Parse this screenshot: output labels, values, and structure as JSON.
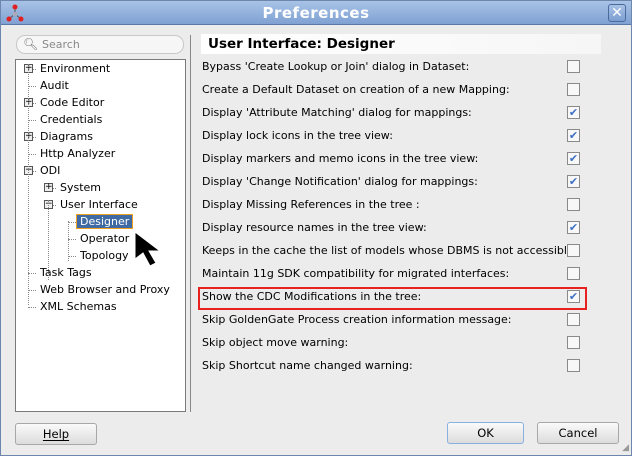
{
  "window": {
    "title": "Preferences"
  },
  "search": {
    "placeholder": "Search"
  },
  "tree": [
    {
      "label": "Environment",
      "level": 0,
      "expander": "+"
    },
    {
      "label": "Audit",
      "level": 0,
      "expander": ""
    },
    {
      "label": "Code Editor",
      "level": 0,
      "expander": "+"
    },
    {
      "label": "Credentials",
      "level": 0,
      "expander": ""
    },
    {
      "label": "Diagrams",
      "level": 0,
      "expander": "+"
    },
    {
      "label": "Http Analyzer",
      "level": 0,
      "expander": ""
    },
    {
      "label": "ODI",
      "level": 0,
      "expander": "−"
    },
    {
      "label": "System",
      "level": 1,
      "expander": "+"
    },
    {
      "label": "User Interface",
      "level": 1,
      "expander": "−"
    },
    {
      "label": "Designer",
      "level": 2,
      "expander": "",
      "selected": true
    },
    {
      "label": "Operator",
      "level": 2,
      "expander": ""
    },
    {
      "label": "Topology",
      "level": 2,
      "expander": ""
    },
    {
      "label": "Task Tags",
      "level": 0,
      "expander": ""
    },
    {
      "label": "Web Browser and Proxy",
      "level": 0,
      "expander": ""
    },
    {
      "label": "XML Schemas",
      "level": 0,
      "expander": ""
    }
  ],
  "panel": {
    "title": "User Interface: Designer",
    "options": [
      {
        "label": "Bypass 'Create Lookup or Join' dialog in Dataset:",
        "checked": false
      },
      {
        "label": "Create a Default Dataset on creation of a new Mapping:",
        "checked": false
      },
      {
        "label": "Display 'Attribute Matching' dialog for mappings:",
        "checked": true
      },
      {
        "label": "Display lock icons in the tree view:",
        "checked": true
      },
      {
        "label": "Display markers and memo icons in the tree view:",
        "checked": true
      },
      {
        "label": "Display 'Change Notification' dialog for mappings:",
        "checked": true
      },
      {
        "label": "Display Missing References in the tree :",
        "checked": false
      },
      {
        "label": "Display resource names in the tree view:",
        "checked": true
      },
      {
        "label": "Keeps in the cache the list of models whose DBMS is not accessible:",
        "checked": false
      },
      {
        "label": "Maintain 11g SDK compatibility for migrated interfaces:",
        "checked": false
      },
      {
        "label": "Show the CDC Modifications in the tree:",
        "checked": true,
        "highlighted": true
      },
      {
        "label": "Skip GoldenGate Process creation information message:",
        "checked": false
      },
      {
        "label": "Skip object move warning:",
        "checked": false
      },
      {
        "label": "Skip Shortcut name changed warning:",
        "checked": false
      }
    ]
  },
  "buttons": {
    "help": "Help",
    "ok": "OK",
    "cancel": "Cancel"
  },
  "colors": {
    "selection": "#3f6aa3",
    "highlight_border": "#e82020",
    "titlebar": "#8fb0dc"
  }
}
